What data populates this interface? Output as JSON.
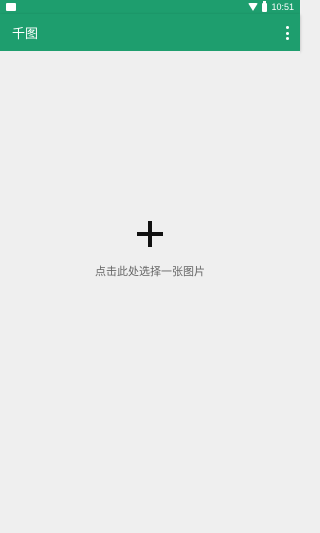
{
  "status_bar": {
    "time": "10:51",
    "icons": [
      "notification-icon",
      "wifi-icon",
      "battery-icon"
    ]
  },
  "app_bar": {
    "title": "千图",
    "menu_icon": "more-vert-icon"
  },
  "main": {
    "add_icon": "plus-icon",
    "prompt": "点击此处选择一张图片"
  },
  "colors": {
    "primary": "#1e9e6e",
    "background": "#efefef",
    "icon": "#111111",
    "label": "#666666"
  }
}
